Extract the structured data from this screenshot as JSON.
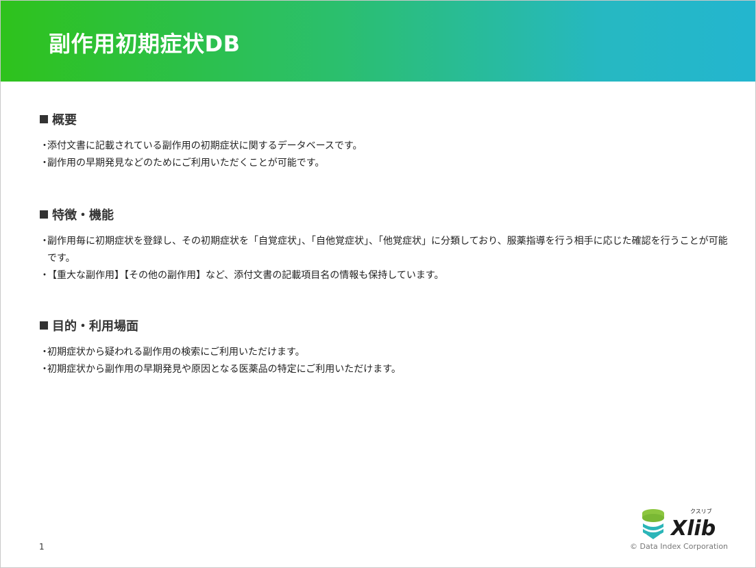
{
  "header": {
    "title": "副作用初期症状DB"
  },
  "sections": [
    {
      "heading": "概要",
      "bullets": [
        "添付文書に記載されている副作用の初期症状に関するデータベースです。",
        "副作用の早期発見などのためにご利用いただくことが可能です。"
      ]
    },
    {
      "heading": "特徴・機能",
      "bullets": [
        "副作用毎に初期症状を登録し、その初期症状を「自覚症状」、「自他覚症状」、「他覚症状」に分類しており、服薬指導を行う相手に応じた確認を行うことが可能です。",
        "【重大な副作用】【その他の副作用】など、添付文書の記載項目名の情報も保持しています。"
      ]
    },
    {
      "heading": "目的・利用場面",
      "bullets": [
        "初期症状から疑われる副作用の検索にご利用いただけます。",
        "初期症状から副作用の早期発見や原因となる医薬品の特定にご利用いただけます。"
      ]
    }
  ],
  "bullet_marker": "・",
  "footer": {
    "page_number": "1",
    "logo_text": "Xlib",
    "logo_ruby": "クスリブ",
    "copyright": "© Data Index Corporation"
  },
  "colors": {
    "header_gradient_start": "#2ec21c",
    "header_gradient_end": "#23b6cf",
    "logo_green": "#8cc63f",
    "logo_teal": "#2bb5b8"
  }
}
